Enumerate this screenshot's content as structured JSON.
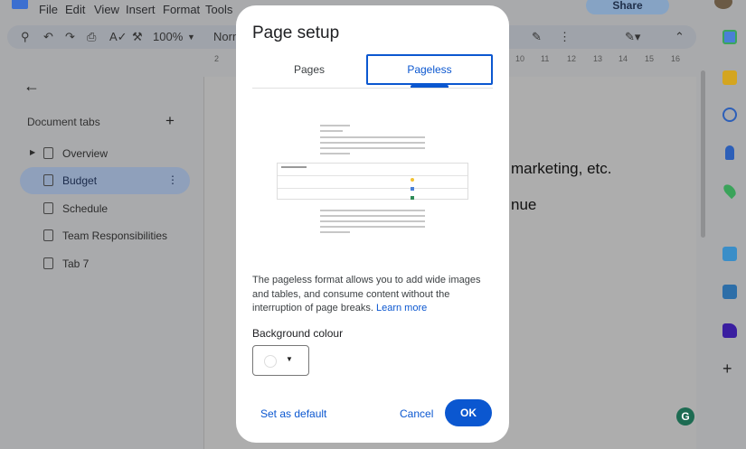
{
  "menu": {
    "items": [
      "File",
      "Edit",
      "View",
      "Insert",
      "Format",
      "Tools"
    ],
    "share": "Share"
  },
  "toolbar": {
    "zoom": "100%",
    "style": "Normal text"
  },
  "ruler": [
    "2",
    "10",
    "11",
    "12",
    "13",
    "14",
    "15",
    "16"
  ],
  "sidebar": {
    "title": "Document tabs",
    "tabs": [
      {
        "label": "Overview"
      },
      {
        "label": "Budget"
      },
      {
        "label": "Schedule"
      },
      {
        "label": "Team Responsibilities"
      },
      {
        "label": "Tab 7"
      }
    ]
  },
  "document": {
    "line1": "marketing, etc.",
    "line2": "nue"
  },
  "dialog": {
    "title": "Page setup",
    "tabs": [
      {
        "label": "Pages"
      },
      {
        "label": "Pageless"
      }
    ],
    "description": "The pageless format allows you to add wide images and tables, and consume content without the interruption of page breaks.",
    "learn_more": "Learn more",
    "bg_label": "Background colour",
    "set_default": "Set as default",
    "cancel": "Cancel",
    "ok": "OK"
  },
  "colors": {
    "accent": "#0b57d0",
    "selected_tab": "#8fa0bb"
  }
}
